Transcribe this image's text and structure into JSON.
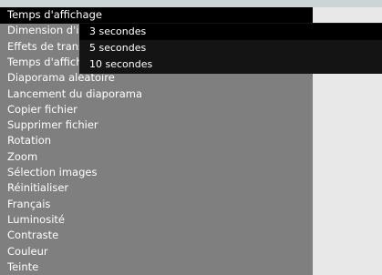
{
  "menu": {
    "items": [
      {
        "label": "Temps d'affichage"
      },
      {
        "label": "Dimension d'image"
      },
      {
        "label": "Effets de transition"
      },
      {
        "label": "Temps d'affichage"
      },
      {
        "label": "Diaporama aléatoire"
      },
      {
        "label": "Lancement du diaporama"
      },
      {
        "label": "Copier fichier"
      },
      {
        "label": "Supprimer fichier"
      },
      {
        "label": "Rotation"
      },
      {
        "label": "Zoom"
      },
      {
        "label": "Sélection images"
      },
      {
        "label": "Réinitialiser"
      },
      {
        "label": "Français"
      },
      {
        "label": "Luminosité"
      },
      {
        "label": "Contraste"
      },
      {
        "label": "Couleur"
      },
      {
        "label": "Teinte"
      }
    ]
  },
  "submenu": {
    "options": [
      {
        "label": "3 secondes"
      },
      {
        "label": "5 secondes"
      },
      {
        "label": "10 secondes"
      }
    ]
  },
  "colors": {
    "menu_background": "#7f7f7f",
    "selected_row": "#000000",
    "submenu_background": "#141414",
    "text": "#ffffff"
  }
}
